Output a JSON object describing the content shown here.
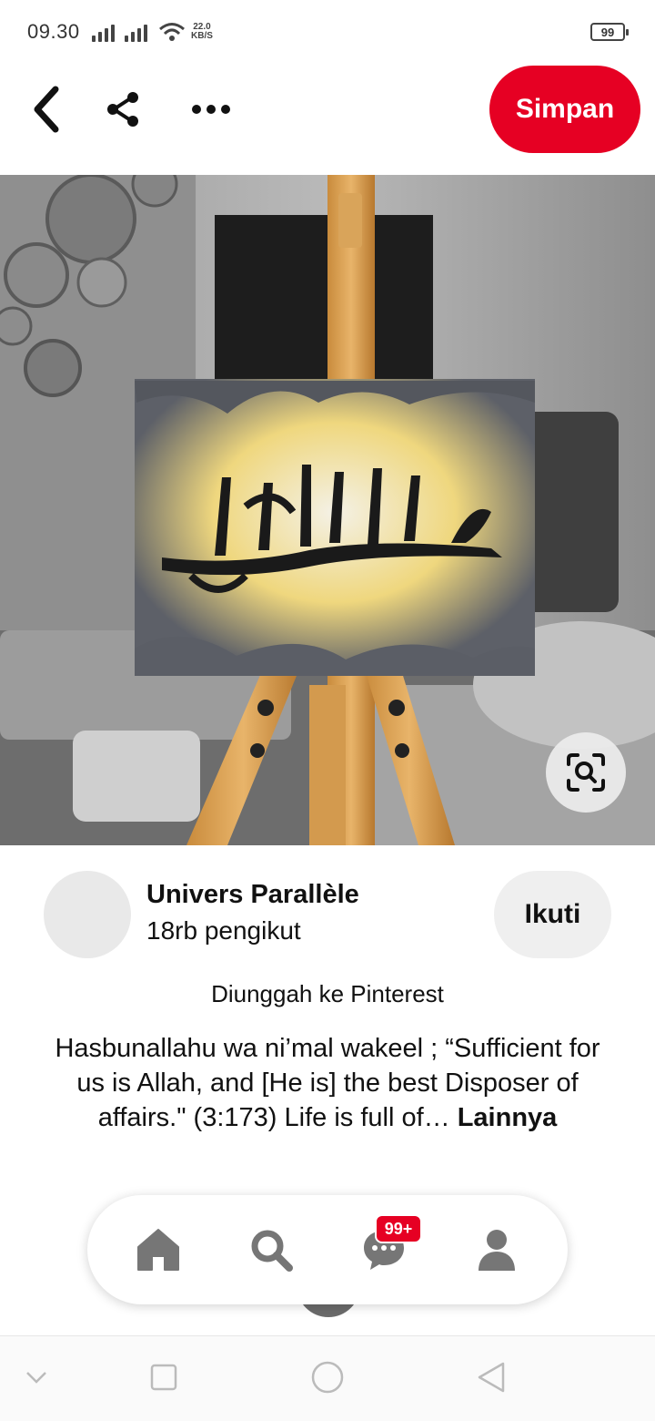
{
  "status_bar": {
    "time": "09.30",
    "network_speed_value": "22.0",
    "network_speed_unit": "KB/S",
    "battery": "99"
  },
  "header": {
    "save_label": "Simpan"
  },
  "pin": {
    "creator_name": "Univers Parallèle",
    "followers": "18rb pengikut",
    "follow_label": "Ikuti",
    "uploaded_label": "Diunggah ke Pinterest",
    "description": "Hasbunallahu wa ni’mal wakeel ; “Sufficient for us is Allah, and [He is] the best Disposer of affairs.\" (3:173) Life is full of…",
    "more_label": "Lainnya"
  },
  "bottom_nav": {
    "notification_badge": "99+"
  },
  "colors": {
    "brand": "#e60023",
    "follow_bg": "#efefef",
    "icon_gray": "#767676"
  },
  "icons": [
    "back-icon",
    "share-icon",
    "more-icon",
    "visual-search-icon",
    "home-icon",
    "search-icon",
    "chat-icon",
    "profile-icon"
  ]
}
